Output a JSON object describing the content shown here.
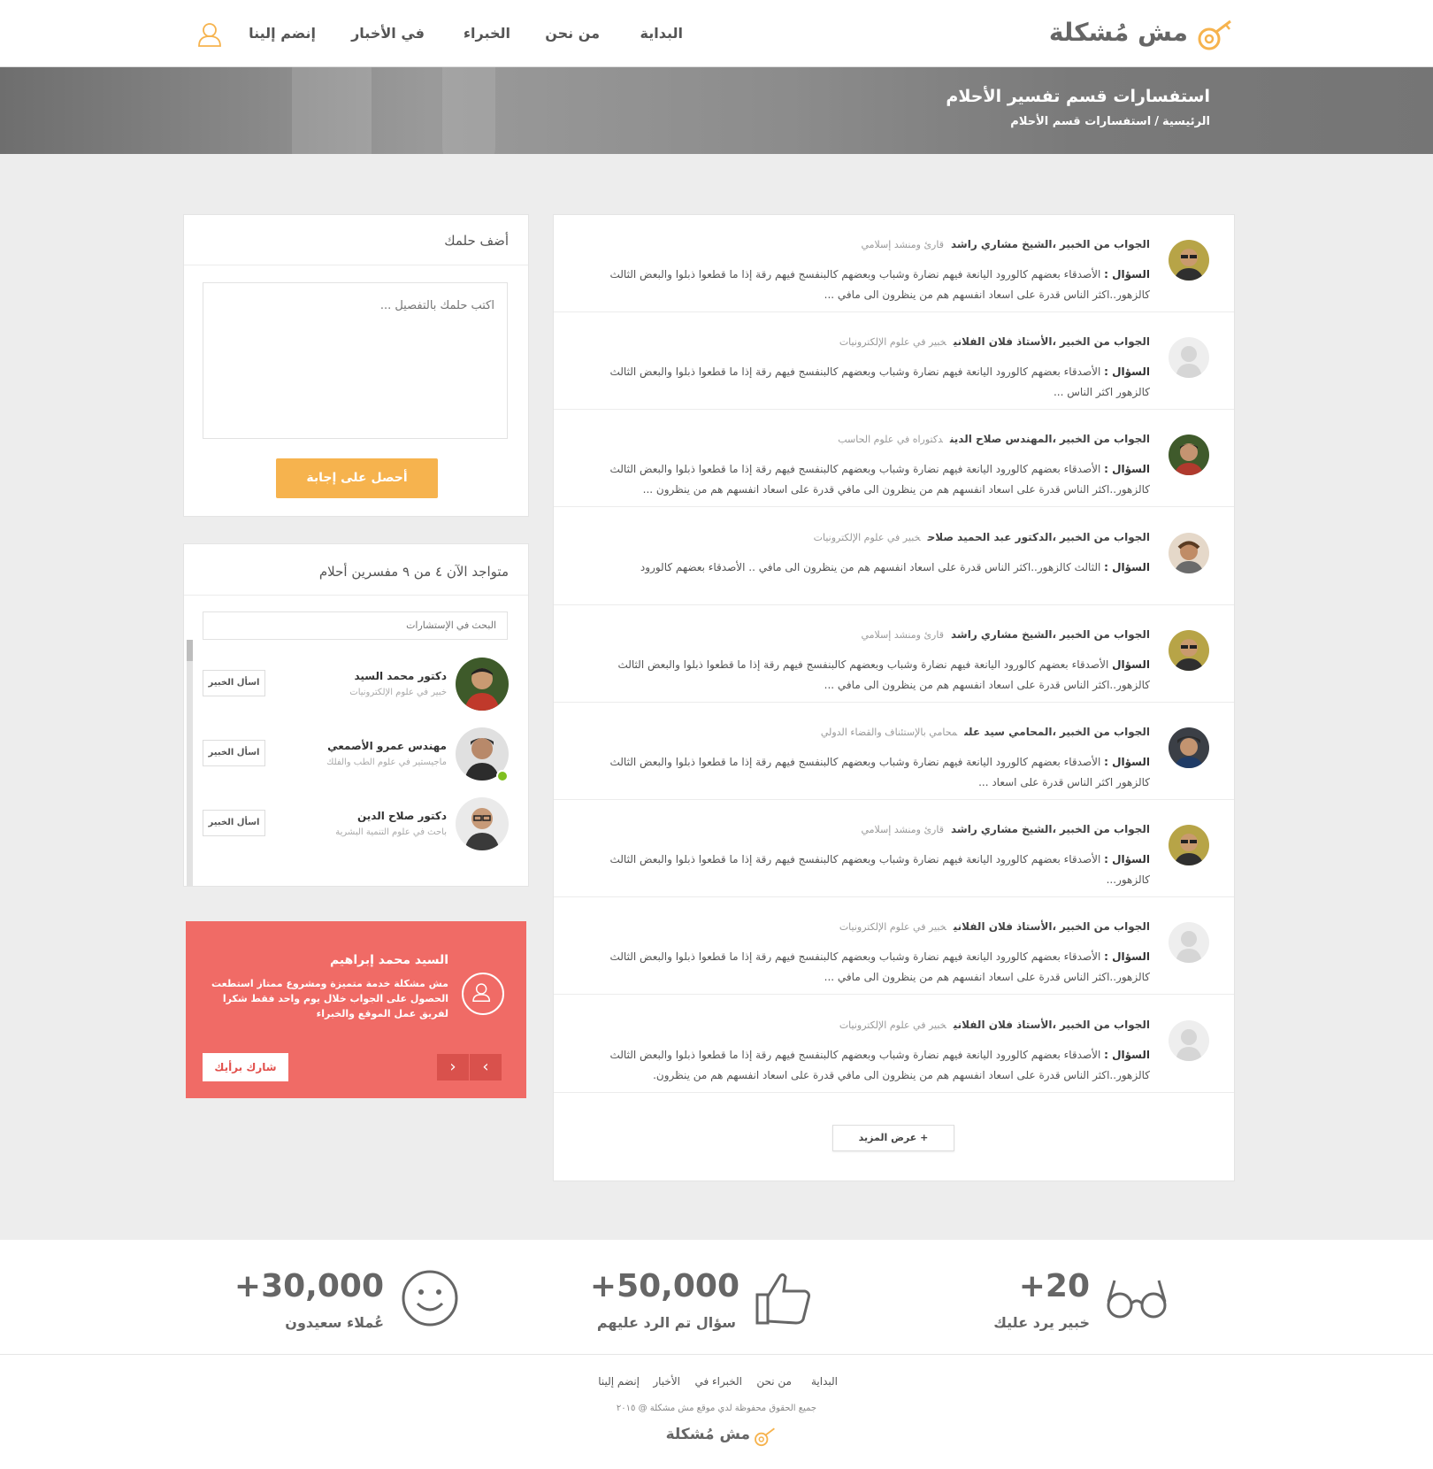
{
  "header": {
    "logo": "مش مُشكلة",
    "nav": [
      "البداية",
      "من نحن",
      "الخبراء",
      "في الأخبار",
      "إنضم إلينا"
    ]
  },
  "banner": {
    "title": "استفسارات قسم تفسير الأحلام",
    "crumb_home": "الرئيسية",
    "crumb_sep": "/",
    "crumb_current": "استفسارات قسم الأحلام"
  },
  "questions": [
    {
      "prefix": "الجواب من الخبير",
      "name": "الشيخ مشاري راشد",
      "role": "قارئ ومنشد إسلامي",
      "q_label": "السؤال :",
      "text": "الأصدقاء بعضهم كالورود اليانعة فيهم نضارة وشباب وبعضهم كالبنفسج فيهم رقة إذا ما قطعوا ذبلوا والبعض الثالث كالزهور..اكثر الناس قدرة على اسعاد انفسهم هم من ينظرون الى مافي ..."
    },
    {
      "prefix": "الجواب من الخبير",
      "name": "الأستاذ فلان الفلاني",
      "role": "خبير في علوم الإلكترونيات",
      "q_label": "السؤال :",
      "text": "الأصدقاء بعضهم كالورود اليانعة فيهم نضارة وشباب وبعضهم كالبنفسج فيهم رقة إذا ما قطعوا ذبلوا والبعض الثالث كالزهور اكثر الناس ..."
    },
    {
      "prefix": "الجواب من الخبير",
      "name": "المهندس صلاح الدين",
      "role": "دكتوراه في علوم الحاسب",
      "q_label": "السؤال :",
      "text": "الأصدقاء بعضهم كالورود اليانعة فيهم نضارة وشباب وبعضهم كالبنفسج فيهم رقة إذا ما قطعوا ذبلوا والبعض الثالث كالزهور..اكثر الناس قدرة على اسعاد انفسهم هم من ينظرون الى مافي  قدرة على اسعاد انفسهم هم من ينظرون ..."
    },
    {
      "prefix": "الجواب من الخبير",
      "name": "الدكتور عبد الحميد صلاح",
      "role": "خبير في علوم الإلكترونيات",
      "q_label": "السؤال :",
      "text": "الثالث كالزهور..اكثر الناس قدرة على اسعاد انفسهم هم من ينظرون الى مافي .. الأصدقاء بعضهم كالورود"
    },
    {
      "prefix": "الجواب من الخبير",
      "name": "الشيخ مشاري راشد",
      "role": "قارئ ومنشد إسلامي",
      "q_label": "السؤال",
      "text": "الأصدقاء بعضهم كالورود اليانعة فيهم نضارة وشباب وبعضهم كالبنفسج فيهم رقة إذا ما قطعوا ذبلوا والبعض الثالث كالزهور..اكثر الناس قدرة على اسعاد انفسهم هم من ينظرون الى مافي ..."
    },
    {
      "prefix": "الجواب من الخبير",
      "name": "المحامي سيد على",
      "role": "محامي بالإستئناف والقضاء الدولي",
      "q_label": "السؤال :",
      "text": "الأصدقاء بعضهم كالورود اليانعة فيهم نضارة وشباب وبعضهم كالبنفسج فيهم رقة إذا ما قطعوا ذبلوا والبعض الثالث كالزهور اكثر الناس قدرة على اسعاد ..."
    },
    {
      "prefix": "الجواب من الخبير",
      "name": "الشيخ مشاري راشد",
      "role": "قارئ ومنشد إسلامي",
      "q_label": "السؤال :",
      "text": "الأصدقاء بعضهم كالورود اليانعة فيهم نضارة وشباب وبعضهم كالبنفسج فيهم رقة إذا ما قطعوا ذبلوا والبعض الثالث كالزهور..."
    },
    {
      "prefix": "الجواب من الخبير",
      "name": "الأستاذ فلان الفلاني",
      "role": "خبير في علوم الإلكترونيات",
      "q_label": "السؤال :",
      "text": "الأصدقاء بعضهم كالورود اليانعة فيهم نضارة وشباب وبعضهم كالبنفسج فيهم رقة إذا ما قطعوا ذبلوا والبعض الثالث كالزهور..اكثر الناس قدرة على اسعاد انفسهم هم من ينظرون الى مافي ..."
    },
    {
      "prefix": "الجواب من الخبير",
      "name": "الأستاذ فلان الفلاني",
      "role": "خبير في علوم الإلكترونيات",
      "q_label": "السؤال :",
      "text": "الأصدقاء بعضهم كالورود اليانعة فيهم نضارة وشباب وبعضهم كالبنفسج فيهم رقة إذا ما قطعوا ذبلوا والبعض الثالث كالزهور..اكثر الناس قدرة على اسعاد انفسهم هم من ينظرون الى مافي قدرة على اسعاد انفسهم هم من ينظرون."
    }
  ],
  "more_label": "+ عرض المزيد",
  "add_dream": {
    "title": "أضف حلمك",
    "placeholder": "اكتب حلمك بالتفصيل ...",
    "button": "أحصل على إجابة"
  },
  "experts": {
    "title": "متواجد الآن ٤ من ٩ مفسرين أحلام",
    "search_placeholder": "البحث في الإستشارات",
    "ask_label": "اسأل الخبير",
    "items": [
      {
        "name": "دكتور محمد السيد",
        "role": "خبير في علوم الإلكترونيات"
      },
      {
        "name": "مهندس عمرو الأصمعي",
        "role": "ماجيستير في علوم الطب والفلك"
      },
      {
        "name": "دكتور صلاح الدين",
        "role": "باحث في علوم التنمية البشرية"
      }
    ]
  },
  "testimonial": {
    "name": "السيد محمد إبراهيم",
    "text": "مش مشكلة خدمة متميزة ومشروع ممتاز استطعت الحصول على الجواب خلال يوم واحد فقط شكرا لفريق عمل الموقع والخبراء",
    "share_button": "شارك برأيك",
    "prev": "‹",
    "next": "›"
  },
  "stats": [
    {
      "value": "+20",
      "label": "خبير يرد عليك",
      "icon": "glasses-icon"
    },
    {
      "value": "+50,000",
      "label": "سؤال تم الرد عليهم",
      "icon": "thumbs-up-icon"
    },
    {
      "value": "+30,000",
      "label": "عُملاء سعيدون",
      "icon": "smiley-icon"
    }
  ],
  "footer": {
    "links": [
      "البداية",
      "من نحن",
      "الخبراء في",
      "الأخبار",
      "إنضم إلينا"
    ],
    "copyright": "جميع الحقوق محفوظة لدي موقع مش مشكلة @ ٢٠١٥",
    "logo": "مش مُشكلة"
  },
  "colors": {
    "accent": "#f6b34e",
    "testimonial_bg": "#f06b66",
    "online": "#7fbf1f"
  }
}
